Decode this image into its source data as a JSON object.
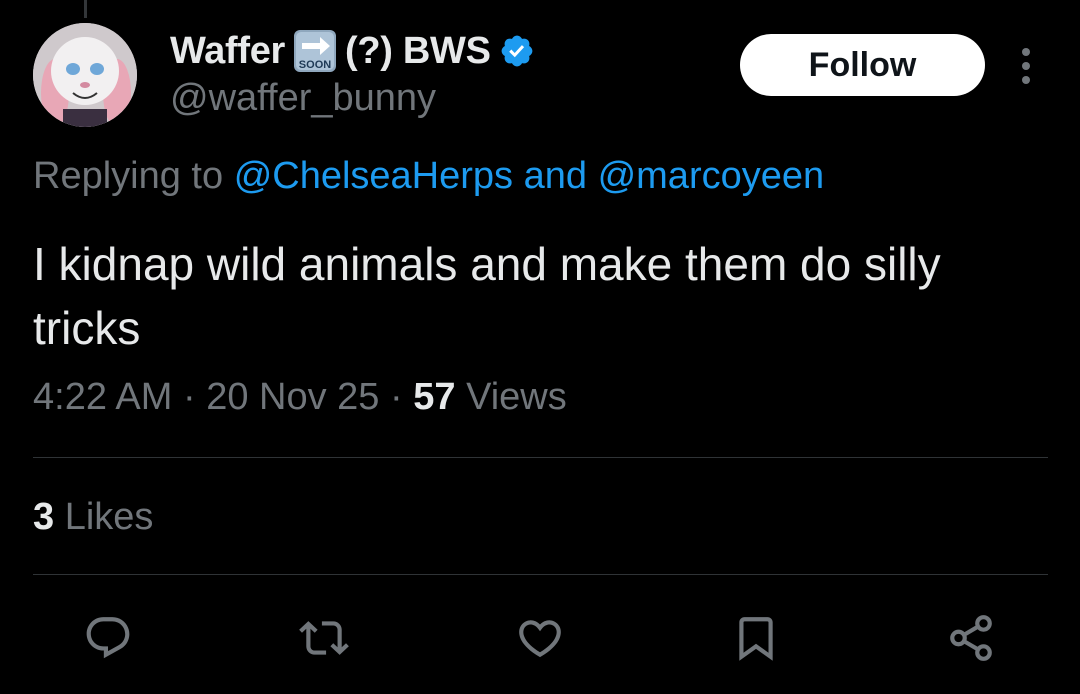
{
  "author": {
    "name": "Waffer",
    "name_suffix": "(?) BWS",
    "handle": "@waffer_bunny",
    "soon_icon_label": "SOON",
    "verified_color": "#1d9bf0"
  },
  "follow_label": "Follow",
  "replying": {
    "prefix": "Replying to",
    "mention1": "@ChelseaHerps",
    "conjunction": "and",
    "mention2": "@marcoyeen"
  },
  "tweet": {
    "text": "I kidnap wild animals and make them do silly tricks"
  },
  "meta": {
    "time": "4:22 AM",
    "sep1": "·",
    "date": "20 Nov 25",
    "sep2": "·",
    "views_count": "57",
    "views_label": "Views"
  },
  "likes": {
    "count": "3",
    "label": "Likes"
  },
  "actions": [
    "reply-icon",
    "retweet-icon",
    "like-icon",
    "bookmark-icon",
    "share-icon"
  ],
  "colors": {
    "background": "#000000",
    "text": "#e7e9ea",
    "secondary": "#71767b",
    "link": "#1d9bf0",
    "divider": "#2f3336"
  }
}
